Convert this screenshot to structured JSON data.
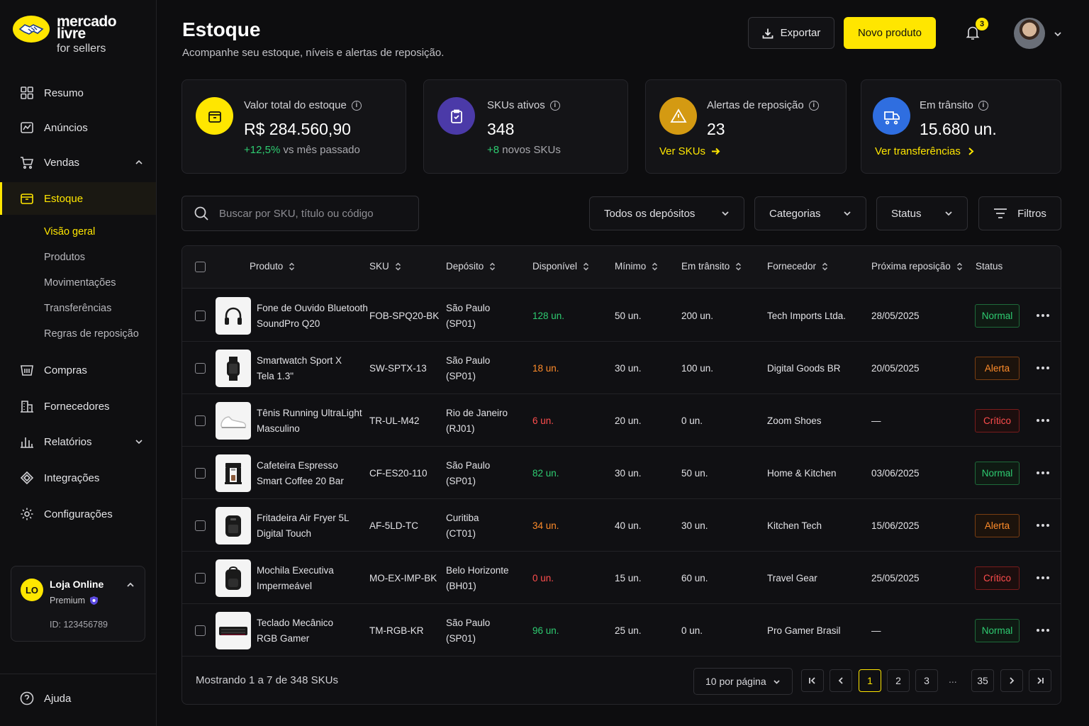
{
  "brand": {
    "line1": "mercado",
    "line2": "livre",
    "line3": "for sellers"
  },
  "sidebar": {
    "items": [
      {
        "label": "Resumo"
      },
      {
        "label": "Anúncios"
      },
      {
        "label": "Vendas"
      },
      {
        "label": "Estoque"
      },
      {
        "label": "Compras"
      },
      {
        "label": "Fornecedores"
      },
      {
        "label": "Relatórios"
      },
      {
        "label": "Integrações"
      },
      {
        "label": "Configurações"
      }
    ],
    "subitems": [
      {
        "label": "Visão geral"
      },
      {
        "label": "Produtos"
      },
      {
        "label": "Movimentações"
      },
      {
        "label": "Transferências"
      },
      {
        "label": "Regras de reposição"
      }
    ],
    "account": {
      "initials": "LO",
      "name": "Loja Online",
      "plan": "Premium",
      "id": "ID: 123456789"
    },
    "help": "Ajuda"
  },
  "header": {
    "title": "Estoque",
    "subtitle": "Acompanhe seu estoque, níveis e alertas de reposição.",
    "export_label": "Exportar",
    "new_label": "Novo produto",
    "notifications": "3"
  },
  "cards": [
    {
      "label": "Valor total do estoque",
      "value": "R$ 284.560,90",
      "delta": "+12,5%",
      "foot": " vs mês passado",
      "icon": "box-icon",
      "color": "#ffe600"
    },
    {
      "label": "SKUs ativos",
      "value": "348",
      "delta": "+8",
      "foot": " novos SKUs",
      "icon": "clipboard-icon",
      "color": "#4b3aa8"
    },
    {
      "label": "Alertas de reposição",
      "value": "23",
      "link": "Ver SKUs",
      "icon": "warning-icon",
      "color": "#d49a12"
    },
    {
      "label": "Em trânsito",
      "value": "15.680 un.",
      "link": "Ver transferências",
      "icon": "truck-icon",
      "color": "#2f6ee0"
    }
  ],
  "filters": {
    "search_placeholder": "Buscar por SKU, título ou código",
    "warehouse": "Todos os depósitos",
    "category": "Categorias",
    "status": "Status",
    "filters_label": "Filtros"
  },
  "table": {
    "columns": [
      "Produto",
      "SKU",
      "Depósito",
      "Disponível",
      "Mínimo",
      "Em trânsito",
      "Fornecedor",
      "Próxima reposição",
      "Status"
    ],
    "rows": [
      {
        "name1": "Fone de Ouvido Bluetooth",
        "name2": "SoundPro Q20",
        "sku": "FOB-SPQ20-BK",
        "dep1": "São Paulo",
        "dep2": "(SP01)",
        "avail": "128 un.",
        "min": "50 un.",
        "transit": "200 un.",
        "supplier": "Tech Imports Ltda.",
        "next": "28/05/2025",
        "status": "Normal",
        "level": "ok",
        "icon": "headphones-icon"
      },
      {
        "name1": "Smartwatch Sport X",
        "name2": "Tela 1.3\"",
        "sku": "SW-SPTX-13",
        "dep1": "São Paulo",
        "dep2": "(SP01)",
        "avail": "18 un.",
        "min": "30 un.",
        "transit": "100 un.",
        "supplier": "Digital Goods BR",
        "next": "20/05/2025",
        "status": "Alerta",
        "level": "warn",
        "icon": "smartwatch-icon"
      },
      {
        "name1": "Tênis Running UltraLight",
        "name2": "Masculino",
        "sku": "TR-UL-M42",
        "dep1": "Rio de Janeiro",
        "dep2": "(RJ01)",
        "avail": "6 un.",
        "min": "20 un.",
        "transit": "0 un.",
        "supplier": "Zoom Shoes",
        "next": "—",
        "status": "Crítico",
        "level": "crit",
        "icon": "sneaker-icon"
      },
      {
        "name1": "Cafeteira Espresso",
        "name2": "Smart Coffee 20 Bar",
        "sku": "CF-ES20-110",
        "dep1": "São Paulo",
        "dep2": "(SP01)",
        "avail": "82 un.",
        "min": "30 un.",
        "transit": "50 un.",
        "supplier": "Home & Kitchen",
        "next": "03/06/2025",
        "status": "Normal",
        "level": "ok",
        "icon": "coffee-maker-icon"
      },
      {
        "name1": "Fritadeira Air Fryer 5L",
        "name2": "Digital Touch",
        "sku": "AF-5LD-TC",
        "dep1": "Curitiba",
        "dep2": "(CT01)",
        "avail": "34 un.",
        "min": "40 un.",
        "transit": "30 un.",
        "supplier": "Kitchen Tech",
        "next": "15/06/2025",
        "status": "Alerta",
        "level": "warn",
        "icon": "air-fryer-icon"
      },
      {
        "name1": "Mochila Executiva",
        "name2": "Impermeável",
        "sku": "MO-EX-IMP-BK",
        "dep1": "Belo Horizonte",
        "dep2": "(BH01)",
        "avail": "0 un.",
        "min": "15 un.",
        "transit": "60 un.",
        "supplier": "Travel Gear",
        "next": "25/05/2025",
        "status": "Crítico",
        "level": "crit",
        "icon": "backpack-icon"
      },
      {
        "name1": "Teclado Mecânico",
        "name2": "RGB Gamer",
        "sku": "TM-RGB-KR",
        "dep1": "São Paulo",
        "dep2": "(SP01)",
        "avail": "96 un.",
        "min": "25 un.",
        "transit": "0 un.",
        "supplier": "Pro Gamer Brasil",
        "next": "—",
        "status": "Normal",
        "level": "ok",
        "icon": "keyboard-icon"
      }
    ],
    "footer": "Mostrando 1 a 7 de 348 SKUs",
    "per_page": "10 por página",
    "pages": [
      "1",
      "2",
      "3",
      "35"
    ],
    "dots": "..."
  },
  "colors": {
    "accent": "#ffe600",
    "ok": "#2ecc71",
    "warn": "#ff8c2a",
    "crit": "#ff4d4d"
  }
}
